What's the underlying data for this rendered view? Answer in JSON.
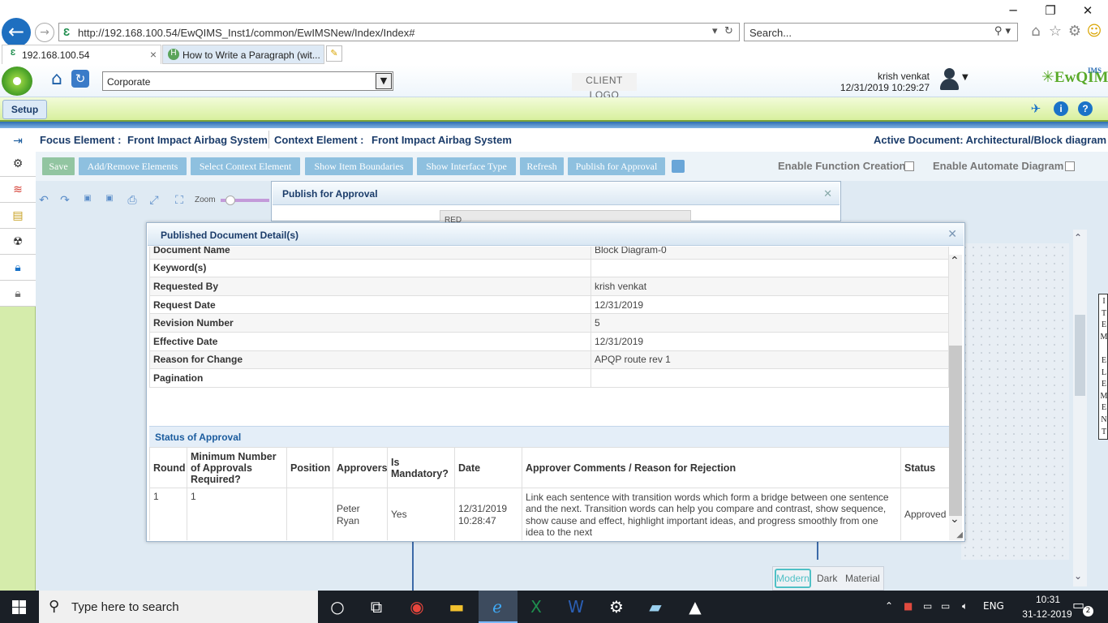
{
  "browser": {
    "url": "http://192.168.100.54/EwQIMS_Inst1/common/EwIMSNew/Index/Index#",
    "search_placeholder": "Search...",
    "tabs": [
      {
        "label": "192.168.100.54",
        "active": true
      },
      {
        "label": "How to Write a Paragraph (wit...",
        "active": false
      }
    ],
    "icons": [
      "back-icon",
      "forward-icon",
      "refresh-icon",
      "search-icon",
      "home-icon",
      "favorites-star-icon",
      "settings-gear-icon",
      "smiley-feedback-icon"
    ]
  },
  "app": {
    "org_select": "Corporate",
    "client_logo": "CLIENT LOGO",
    "user_name": "krish venkat",
    "user_datetime": "12/31/2019 10:29:27",
    "brand": "EwQIMS",
    "brand_sup": "IMS",
    "setup_label": "Setup",
    "accent_color": "#1a73c8",
    "menu_green": "#d5ecab"
  },
  "focus_bar": {
    "focus_label": "Focus Element :",
    "focus_value": "Front Impact Airbag System",
    "context_label": "Context Element :",
    "context_value": "Front Impact Airbag System",
    "active_document": "Active Document: Architectural/Block diagram"
  },
  "toolbar": {
    "buttons": [
      "Save",
      "Add/Remove Elements",
      "Select Context Element",
      "Show Item Boundaries",
      "Show Interface Type",
      "Refresh",
      "Publish for Approval"
    ],
    "enable_function_creation": "Enable Function Creation",
    "enable_automate_diagram": "Enable Automate Diagram",
    "zoom_label": "Zoom"
  },
  "side_panel": {
    "item_element": "I\nT\nE\nM\n \nE\nL\nE\nM\nE\nN\nT"
  },
  "theme": {
    "options": [
      "Modern",
      "Dark",
      "Material"
    ],
    "selected": "Modern"
  },
  "publish_dialog": {
    "title": "Publish for Approval",
    "field_partial": "RED"
  },
  "detail_dialog": {
    "title": "Published Document Detail(s)",
    "rows": [
      {
        "label": "Document Name",
        "value": "Block Diagram-0"
      },
      {
        "label": "Keyword(s)",
        "value": ""
      },
      {
        "label": "Requested By",
        "value": "krish venkat"
      },
      {
        "label": "Request Date",
        "value": "12/31/2019"
      },
      {
        "label": "Revision Number",
        "value": "5"
      },
      {
        "label": "Effective Date",
        "value": "12/31/2019"
      },
      {
        "label": "Reason for Change",
        "value": "APQP route rev 1"
      },
      {
        "label": "Pagination",
        "value": ""
      }
    ],
    "status_title": "Status of Approval",
    "status_columns": [
      "Round",
      "Minimum Number of Approvals Required?",
      "Position",
      "Approvers",
      "Is Mandatory?",
      "Date",
      "Approver Comments / Reason for Rejection",
      "Status"
    ],
    "status_rows": [
      {
        "round": "1",
        "min_approvals": "1",
        "position": "",
        "approvers": "Peter Ryan",
        "mandatory": "Yes",
        "date": "12/31/2019 10:28:47",
        "comments": "Link each sentence with transition words which form a bridge between one sentence and the next. Transition words can help you compare and contrast, show sequence, show cause and effect, highlight important ideas, and progress smoothly from one idea to the next",
        "status": "Approved"
      }
    ]
  },
  "taskbar": {
    "search_placeholder": "Type here to search",
    "language": "ENG",
    "time": "10:31",
    "date": "31-12-2019",
    "notification_count": "2"
  }
}
